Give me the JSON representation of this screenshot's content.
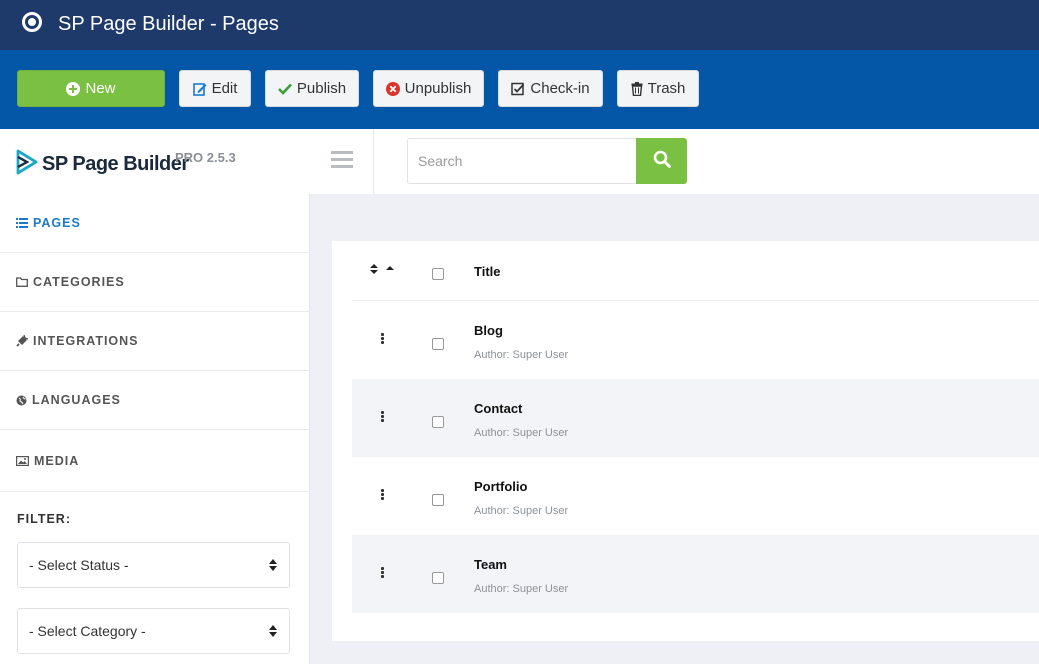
{
  "app": {
    "title": "SP Page Builder - Pages"
  },
  "toolbar": {
    "new_label": "New",
    "edit_label": "Edit",
    "publish_label": "Publish",
    "unpublish_label": "Unpublish",
    "checkin_label": "Check-in",
    "trash_label": "Trash"
  },
  "brand": {
    "name": "SP Page Builder",
    "version": "PRO 2.5.3"
  },
  "search": {
    "placeholder": "Search",
    "value": ""
  },
  "sidebar": {
    "items": [
      {
        "label": "PAGES",
        "icon": "list-icon",
        "active": true
      },
      {
        "label": "CATEGORIES",
        "icon": "folder-icon"
      },
      {
        "label": "INTEGRATIONS",
        "icon": "plug-icon"
      },
      {
        "label": "LANGUAGES",
        "icon": "globe-icon"
      },
      {
        "label": "MEDIA",
        "icon": "image-icon"
      }
    ],
    "filter_label": "FILTER:",
    "status_select": "- Select Status -",
    "category_select": "- Select Category -"
  },
  "table": {
    "columns": {
      "title": "Title"
    },
    "rows": [
      {
        "title": "Blog",
        "author": "Author: Super User"
      },
      {
        "title": "Contact",
        "author": "Author: Super User"
      },
      {
        "title": "Portfolio",
        "author": "Author: Super User"
      },
      {
        "title": "Team",
        "author": "Author: Super User"
      }
    ]
  },
  "colors": {
    "titlebar": "#1e3a6b",
    "toolbar": "#0456a7",
    "accent_green": "#7ac143",
    "active_link": "#1b7ad0",
    "unpublish_red": "#d9342b"
  }
}
